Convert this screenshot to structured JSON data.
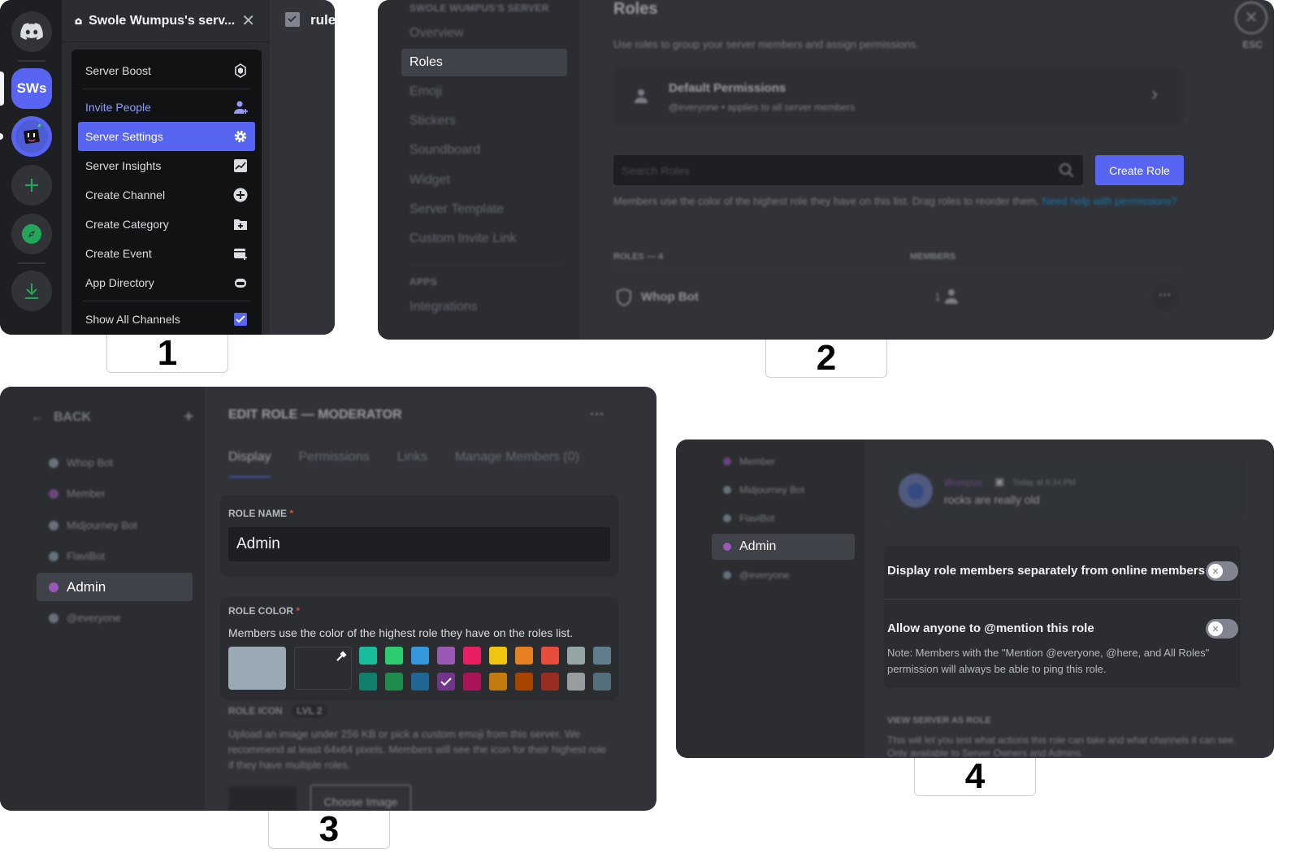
{
  "step_labels": [
    "1",
    "2",
    "3",
    "4"
  ],
  "panel1": {
    "server_name": "Swole Wumpus's serv...",
    "rail": {
      "server_initials": "SWs"
    },
    "channel_tab": "rule",
    "menu_items": [
      {
        "label": "Server Boost",
        "icon": "boost-gem-icon"
      },
      {
        "label": "Invite People",
        "icon": "invite-person-icon",
        "accent": true
      },
      {
        "label": "Server Settings",
        "icon": "gear-icon",
        "active": true
      },
      {
        "label": "Server Insights",
        "icon": "insights-chart-icon"
      },
      {
        "label": "Create Channel",
        "icon": "plus-circle-icon"
      },
      {
        "label": "Create Category",
        "icon": "folder-plus-icon"
      },
      {
        "label": "Create Event",
        "icon": "calendar-plus-icon"
      },
      {
        "label": "App Directory",
        "icon": "robot-icon"
      },
      {
        "label": "Show All Channels",
        "icon": "checkbox-checked-icon",
        "checked": true
      }
    ]
  },
  "panel2": {
    "server_heading": "SWOLE WUMPUS'S SERVER",
    "sidebar_items": [
      "Overview",
      "Roles",
      "Emoji",
      "Stickers",
      "Soundboard",
      "Widget",
      "Server Template",
      "Custom Invite Link"
    ],
    "sidebar_active": "Roles",
    "apps_heading": "APPS",
    "apps_items": [
      "Integrations"
    ],
    "title": "Roles",
    "description": "Use roles to group your server members and assign permissions.",
    "default_permissions": {
      "title": "Default Permissions",
      "subtitle": "@everyone • applies to all server members"
    },
    "search_placeholder": "Search Roles",
    "create_role_label": "Create Role",
    "hint": "Members use the color of the highest role they have on this list. Drag roles to reorder them.",
    "help_link": "Need help with permissions?",
    "table": {
      "roles_header": "ROLES — 4",
      "members_header": "MEMBERS",
      "rows": [
        {
          "name": "Whop Bot",
          "members": "1"
        }
      ]
    },
    "close_label": "ESC"
  },
  "panel3": {
    "back_label": "BACK",
    "title": "EDIT ROLE — MODERATOR",
    "tabs": [
      "Display",
      "Permissions",
      "Links",
      "Manage Members (0)"
    ],
    "active_tab": "Display",
    "roles": [
      {
        "name": "Whop Bot",
        "color": "#99aab5"
      },
      {
        "name": "Member",
        "color": "#9b59b6"
      },
      {
        "name": "Midjourney Bot",
        "color": "#99aab5"
      },
      {
        "name": "FlaviBot",
        "color": "#99aab5"
      },
      {
        "name": "Admin",
        "color": "#9b59b6",
        "active": true
      },
      {
        "name": "@everyone",
        "color": "#99aab5"
      }
    ],
    "role_name_label": "ROLE NAME",
    "role_name_value": "Admin",
    "role_color_label": "ROLE COLOR",
    "role_color_desc": "Members use the color of the highest role they have on the roles list.",
    "default_color": "#99aab5",
    "swatches_row1": [
      "#1abc9c",
      "#2ecc71",
      "#3498db",
      "#9b59b6",
      "#e91e63",
      "#f1c40f",
      "#e67e22",
      "#e74c3c",
      "#95a5a6",
      "#607d8b"
    ],
    "swatches_row2": [
      "#11806a",
      "#1f8b4c",
      "#206694",
      "#71368a",
      "#ad1457",
      "#c27c0e",
      "#a84300",
      "#992d22",
      "#979c9f",
      "#546e7a"
    ],
    "selected_swatch": "#71368a",
    "role_icon_label": "ROLE ICON",
    "role_icon_level": "LVL 2",
    "role_icon_desc": "Upload an image under 256 KB or pick a custom emoji from this server. We recommend at least 64x64 pixels. Members will see the icon for their highest role if they have multiple roles.",
    "choose_image_label": "Choose Image"
  },
  "panel4": {
    "roles": [
      {
        "name": "Member",
        "color": "#9b59b6"
      },
      {
        "name": "Midjourney Bot",
        "color": "#99aab5"
      },
      {
        "name": "FlaviBot",
        "color": "#99aab5"
      },
      {
        "name": "Admin",
        "color": "#9b59b6",
        "active": true
      },
      {
        "name": "@everyone",
        "color": "#99aab5"
      }
    ],
    "preview": {
      "username": "Wumpus",
      "timestamp": "Today at 6:34 PM",
      "message": "rocks are really old"
    },
    "option_display_separately": {
      "label": "Display role members separately from online members",
      "enabled": false
    },
    "option_mention": {
      "label_prefix": "Allow anyone to ",
      "label_bold": "@mention",
      "label_suffix": " this role",
      "enabled": false,
      "note": "Note: Members with the \"Mention @everyone, @here, and All Roles\" permission will always be able to ping this role."
    },
    "view_as_heading": "VIEW SERVER AS ROLE",
    "view_as_desc": "This will let you test what actions this role can take and what channels it can see. Only available to Server Owners and Admins."
  }
}
